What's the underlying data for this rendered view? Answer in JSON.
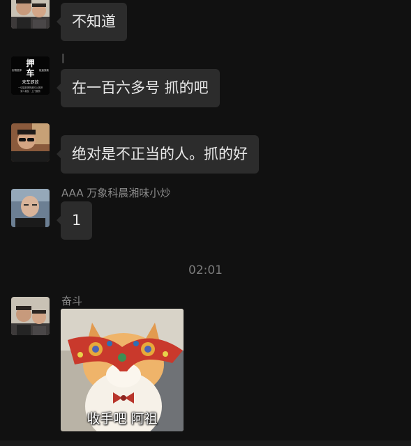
{
  "colors": {
    "background": "#111111",
    "bubble": "#2c2c2c",
    "text": "#e8e8e8",
    "sender_name": "#8a8a8a",
    "timestamp": "#7a7a7a"
  },
  "messages": [
    {
      "sender": "",
      "avatar": "two-men-photo",
      "text": "不知道"
    },
    {
      "sender": "|",
      "avatar": "押车-logo",
      "avatar_text": {
        "main_top": "押",
        "main_bottom": "车",
        "left": "实物抵押",
        "right": "极速放款",
        "sub": "来车即放",
        "fine1": "一切能抵押的都可以抵押",
        "fine2": "家人朋友 · 上门服务"
      },
      "text": "在一百六多号 抓的吧"
    },
    {
      "sender": "",
      "avatar": "man-with-sunglasses-photo",
      "text": "绝对是不正当的人。抓的好"
    },
    {
      "sender": "AAA 万象科晨湘味小炒",
      "avatar": "bald-man-photo",
      "text": "1"
    }
  ],
  "timestamp": "02:01",
  "sticker_message": {
    "sender": "奋斗",
    "avatar": "two-men-photo",
    "caption": "收手吧 阿祖",
    "image": "cat-with-colorful-mask-sticker"
  }
}
